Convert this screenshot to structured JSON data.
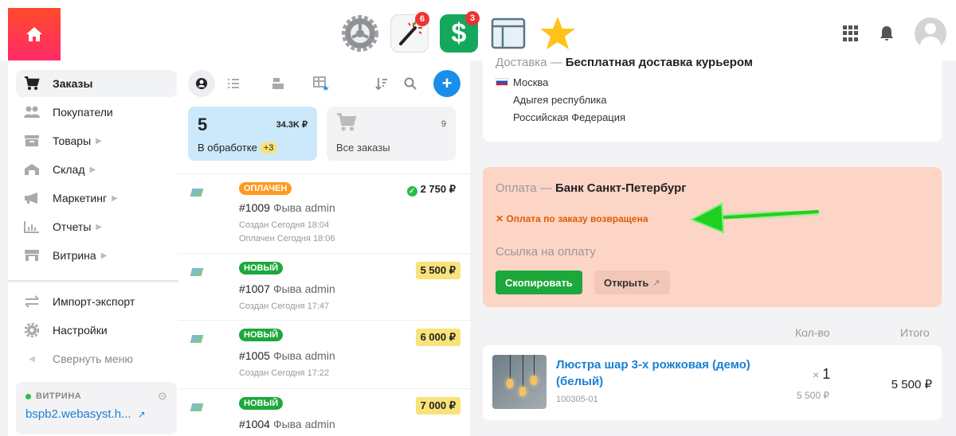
{
  "topbar": {
    "apps": [
      {
        "name": "settings",
        "badge": ""
      },
      {
        "name": "magic",
        "badge": "6"
      },
      {
        "name": "shop",
        "badge": "3"
      },
      {
        "name": "site",
        "badge": ""
      },
      {
        "name": "favorites",
        "badge": ""
      }
    ]
  },
  "sidebar": {
    "items": [
      {
        "label": "Заказы",
        "active": true,
        "icon": "cart-icon"
      },
      {
        "label": "Покупатели",
        "icon": "customers-icon"
      },
      {
        "label": "Товары",
        "icon": "products-icon",
        "chevron": true
      },
      {
        "label": "Склад",
        "icon": "warehouse-icon",
        "chevron": true
      },
      {
        "label": "Маркетинг",
        "icon": "megaphone-icon",
        "chevron": true
      },
      {
        "label": "Отчеты",
        "icon": "chart-icon",
        "chevron": true
      },
      {
        "label": "Витрина",
        "icon": "storefront-icon",
        "chevron": true
      },
      {
        "label": "Импорт-экспорт",
        "icon": "transfer-icon"
      },
      {
        "label": "Настройки",
        "icon": "gear-icon"
      },
      {
        "label": "Свернуть меню",
        "icon": "collapse-icon"
      }
    ],
    "storefront": {
      "title": "ВИТРИНА",
      "link": "bspb2.webasyst.h..."
    }
  },
  "orders": {
    "processing": {
      "count": "5",
      "sum": "34.3K ₽",
      "label": "В обработке",
      "plus": "+3"
    },
    "all": {
      "count": "9",
      "label": "Все заказы"
    },
    "list": [
      {
        "status": "ОПЛАЧЕН",
        "status_type": "paid",
        "amount": "2 750 ₽",
        "number": "#1009",
        "customer": "Фыва admin",
        "created": "Создан Сегодня 18:04",
        "paid": "Оплачен Сегодня 18:06"
      },
      {
        "status": "НОВЫЙ",
        "status_type": "new",
        "amount": "5 500 ₽",
        "number": "#1007",
        "customer": "Фыва admin",
        "created": "Создан Сегодня 17:47"
      },
      {
        "status": "НОВЫЙ",
        "status_type": "new",
        "amount": "6 000 ₽",
        "number": "#1005",
        "customer": "Фыва admin",
        "created": "Создан Сегодня 17:22"
      },
      {
        "status": "НОВЫЙ",
        "status_type": "new",
        "amount": "7 000 ₽",
        "number": "#1004",
        "customer": "Фыва admin"
      }
    ]
  },
  "shipping": {
    "label": "Доставка —",
    "method": "Бесплатная доставка курьером",
    "city": "Москва",
    "region": "Адыгея республика",
    "country": "Российская Федерация"
  },
  "payment": {
    "label": "Оплата —",
    "method": "Банк Санкт-Петербург",
    "refund": "✕ Оплата по заказу возвращена",
    "link_label": "Ссылка на оплату",
    "copy_button": "Скопировать",
    "open_button": "Открыть"
  },
  "items_table": {
    "qty_header": "Кол-во",
    "total_header": "Итого",
    "item": {
      "name": "Люстра шар 3-х рожковая (демо) (белый)",
      "sku": "100305-01",
      "qty": "1",
      "qty_prefix": "×",
      "unit_price": "5 500 ₽",
      "total": "5 500 ₽"
    }
  }
}
